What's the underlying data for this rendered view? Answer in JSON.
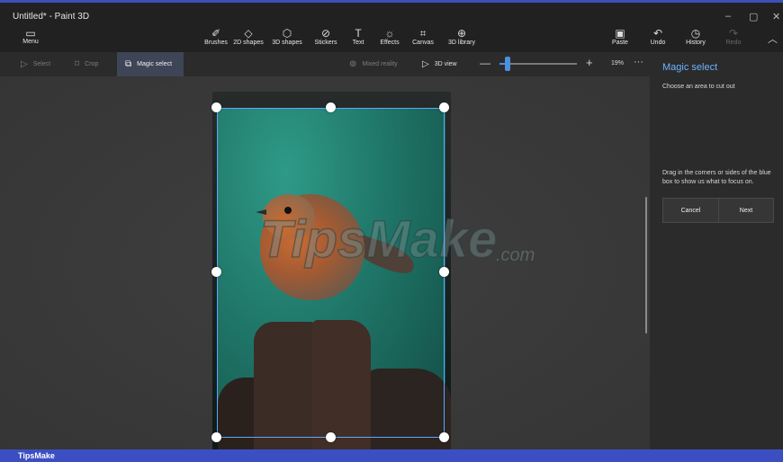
{
  "window": {
    "title": "Untitled* - Paint 3D",
    "minimize": "–",
    "maximize": "▢",
    "close": "✕"
  },
  "menu": {
    "icon": "folder-icon",
    "label": "Menu"
  },
  "tools": [
    {
      "id": "brushes",
      "icon": "brush-icon",
      "glyph": "✐",
      "label": "Brushes"
    },
    {
      "id": "2d-shapes",
      "icon": "2d-shapes-icon",
      "glyph": "◇",
      "label": "2D shapes"
    },
    {
      "id": "3d-shapes",
      "icon": "3d-shapes-icon",
      "glyph": "⬡",
      "label": "3D shapes"
    },
    {
      "id": "stickers",
      "icon": "stickers-icon",
      "glyph": "⊘",
      "label": "Stickers"
    },
    {
      "id": "text",
      "icon": "text-icon",
      "glyph": "T",
      "label": "Text"
    },
    {
      "id": "effects",
      "icon": "effects-icon",
      "glyph": "☼",
      "label": "Effects"
    },
    {
      "id": "canvas",
      "icon": "canvas-icon",
      "glyph": "⌗",
      "label": "Canvas"
    },
    {
      "id": "3d-library",
      "icon": "3d-library-icon",
      "glyph": "⊕",
      "label": "3D library"
    }
  ],
  "actions": [
    {
      "id": "paste",
      "icon": "paste-icon",
      "glyph": "▣",
      "label": "Paste",
      "enabled": true
    },
    {
      "id": "undo",
      "icon": "undo-icon",
      "glyph": "↶",
      "label": "Undo",
      "enabled": true
    },
    {
      "id": "history",
      "icon": "history-icon",
      "glyph": "◷",
      "label": "History",
      "enabled": true
    },
    {
      "id": "redo",
      "icon": "redo-icon",
      "glyph": "↷",
      "label": "Redo",
      "enabled": false
    }
  ],
  "subtoolbar": {
    "select": {
      "glyph": "▷",
      "label": "Select"
    },
    "crop": {
      "glyph": "⌑",
      "label": "Crop"
    },
    "magic_select": {
      "glyph": "⧉",
      "label": "Magic select"
    },
    "mixed_reality": {
      "glyph": "⊚",
      "label": "Mixed reality"
    },
    "view_3d": {
      "glyph": "▷",
      "label": "3D view"
    },
    "zoom": {
      "minus": "—",
      "plus": "+",
      "value": "19%",
      "fraction": 0.1,
      "more": "···"
    }
  },
  "panel": {
    "title": "Magic select",
    "subtitle": "Choose an area to cut out",
    "help": "Drag in the corners or sides of the blue box to show us what to focus on.",
    "cancel_label": "Cancel",
    "next_label": "Next"
  },
  "watermark": {
    "brand": "TipsMake",
    "suffix": ".com"
  },
  "footer": {
    "text": "TipsMake"
  },
  "colors": {
    "accent": "#4a90e2",
    "panel_title": "#6bb4ff",
    "footer": "#3b4fc2"
  }
}
